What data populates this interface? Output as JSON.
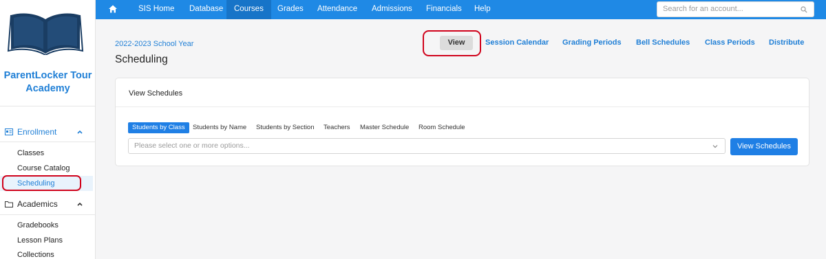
{
  "sidebar": {
    "school_name": "ParentLocker Tour Academy",
    "sections": [
      {
        "label": "Enrollment",
        "icon": "id-card-icon",
        "expanded": true,
        "items": [
          {
            "label": "Classes"
          },
          {
            "label": "Course Catalog"
          },
          {
            "label": "Scheduling",
            "active": true
          }
        ]
      },
      {
        "label": "Academics",
        "icon": "folder-icon",
        "expanded": true,
        "items": [
          {
            "label": "Gradebooks"
          },
          {
            "label": "Lesson Plans"
          },
          {
            "label": "Collections"
          }
        ]
      }
    ]
  },
  "topnav": {
    "items": [
      {
        "label": "SIS Home"
      },
      {
        "label": "Database"
      },
      {
        "label": "Courses",
        "active": true
      },
      {
        "label": "Grades"
      },
      {
        "label": "Attendance"
      },
      {
        "label": "Admissions"
      },
      {
        "label": "Financials"
      },
      {
        "label": "Help"
      }
    ],
    "search_placeholder": "Search for an account..."
  },
  "header": {
    "school_year": "2022-2023 School Year",
    "title": "Scheduling",
    "tabs": [
      {
        "label": "View",
        "active": true
      },
      {
        "label": "Session Calendar"
      },
      {
        "label": "Grading Periods"
      },
      {
        "label": "Bell Schedules"
      },
      {
        "label": "Class Periods"
      },
      {
        "label": "Distribute"
      }
    ]
  },
  "card": {
    "title": "View Schedules",
    "filters": [
      {
        "label": "Students by Class",
        "active": true
      },
      {
        "label": "Students by Name"
      },
      {
        "label": "Students by Section"
      },
      {
        "label": "Teachers"
      },
      {
        "label": "Master Schedule"
      },
      {
        "label": "Room Schedule"
      }
    ],
    "select_placeholder": "Please select one or more options...",
    "button_label": "View Schedules"
  },
  "colors": {
    "accent": "#1f89e5",
    "highlight": "#d0021b"
  }
}
